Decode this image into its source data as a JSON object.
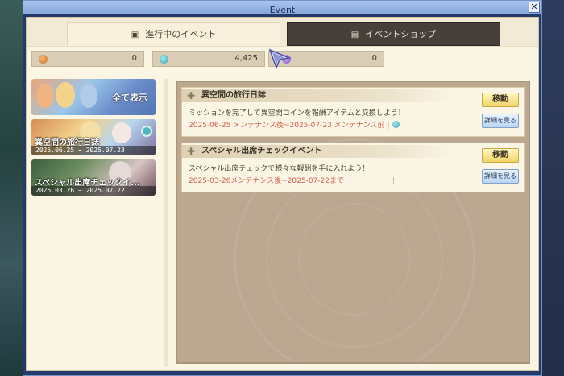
{
  "window": {
    "title": "Event",
    "close_label": "✕"
  },
  "tabs": [
    {
      "label": "進行中のイベント",
      "icon": "home-icon",
      "active": true
    },
    {
      "label": "イベントショップ",
      "icon": "shop-icon",
      "active": false
    }
  ],
  "currencies": [
    {
      "icon": "orange-coin-icon",
      "value": "0",
      "color": "#e0904a"
    },
    {
      "icon": "cyan-coin-icon",
      "value": "4,425",
      "color": "#5cc4cf"
    },
    {
      "icon": "purple-coin-icon",
      "value": "0",
      "color": "#9a6ad8"
    }
  ],
  "sidebar": {
    "show_all_label": "全て表示",
    "banners": [
      {
        "name": "異空間の旅行日誌",
        "dates": "2025.06.25 ~ 2025.07.23"
      },
      {
        "name": "スペシャル出席チェックイ...",
        "dates": "2025.03.26 ~ 2025.07.22"
      }
    ]
  },
  "events": [
    {
      "name": "異空間の旅行日誌",
      "description": "ミッションを完了して異空間コインを報酬アイテムと交換しよう！",
      "period": "2025-06-25 メンテナンス後~2025-07-23 メンテナンス前",
      "move_label": "移動",
      "detail_label": "詳細を見る"
    },
    {
      "name": "スペシャル出席チェックイベント",
      "description": "スペシャル出席チェックで様々な報酬を手に入れよう！",
      "period": "2025-03-26メンテナンス後~2025-07-22まで",
      "move_label": "移動",
      "detail_label": "詳細を見る"
    }
  ]
}
